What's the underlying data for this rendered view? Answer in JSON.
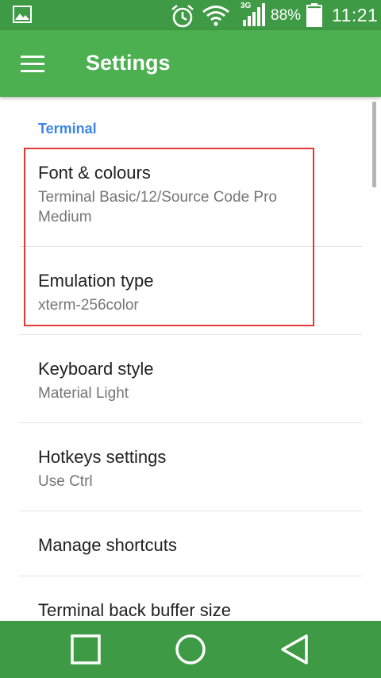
{
  "status_bar": {
    "network_type": "3G",
    "battery_percent": "88%",
    "battery_level": 0.88,
    "time": "11:21",
    "icons": [
      "gallery-icon",
      "alarm-icon",
      "wifi-icon",
      "signal-icon",
      "battery-icon"
    ]
  },
  "app_bar": {
    "title": "Settings",
    "menu_icon": "hamburger-menu-icon",
    "color": "#4caf50"
  },
  "terminal_section": {
    "header": "Terminal",
    "header_color": "#3a86e8",
    "items": [
      {
        "title": "Font & colours",
        "summary": "Terminal Basic/12/Source Code Pro Medium"
      },
      {
        "title": "Emulation type",
        "summary": "xterm-256color"
      },
      {
        "title": "Keyboard style",
        "summary": "Material Light"
      },
      {
        "title": "Hotkeys settings",
        "summary": "Use Ctrl"
      },
      {
        "title": "Manage shortcuts",
        "summary": ""
      },
      {
        "title": "Terminal back buffer size",
        "summary": ""
      }
    ]
  },
  "highlight_color": "#e53935",
  "nav_bar": {
    "buttons": [
      "recents-square-icon",
      "home-circle-icon",
      "back-triangle-icon"
    ]
  }
}
